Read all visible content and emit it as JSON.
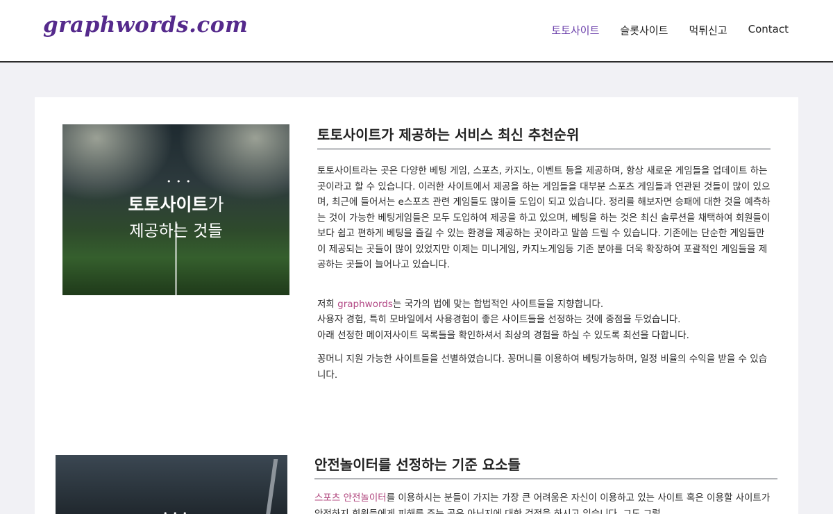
{
  "header": {
    "logo": "graphwords.com",
    "nav": [
      {
        "label": "토토사이트",
        "active": true
      },
      {
        "label": "슬롯사이트",
        "active": false
      },
      {
        "label": "먹튀신고",
        "active": false
      },
      {
        "label": "Contact",
        "active": false
      }
    ]
  },
  "section1": {
    "image": {
      "title_bold": "토토사이트",
      "title_rest": "가",
      "subtitle": "제공하는 것들",
      "dots": "• • •"
    },
    "title": "토토사이트가 제공하는 서비스 최신 추천순위",
    "para1": "토토사이트라는 곳은 다양한 베팅 게임, 스포츠, 카지노, 이벤트 등을 제공하며, 항상 새로운 게임들을 업데이트 하는 곳이라고 할 수 있습니다. 이러한 사이트에서 제공을 하는 게임들을 대부분 스포츠 게임들과 연관된 것들이 많이 있으며, 최근에 들어서는 e스포츠 관련 게임들도 많이들 도입이 되고 있습니다. 정리를 해보자면 승패에 대한 것을 예측하는 것이 가능한 베팅게임들은 모두 도입하여 제공을 하고 있으며, 베팅을 하는 것은 최신 솔루션을 채택하여 회원들이 보다 쉽고 편하게 베팅을 즐길 수 있는 환경을 제공하는 곳이라고 말씀 드릴 수 있습니다. 기존에는 단순한 게임들만이 제공되는 곳들이 많이 있었지만 이제는 미니게임, 카지노게임등 기존 분야를 더욱 확장하여 포괄적인 게임들을 제공하는 곳들이 늘어나고 있습니다.",
    "para2_prefix": "저희 ",
    "para2_brand": "graphwords",
    "para2_suffix": "는 국가의 법에 맞는 합법적인 사이트들을 지향합니다.",
    "para2_line2": "사용자 경험, 특히 모바일에서 사용경험이 좋은 사이트들을 선정하는 것에 중점을 두었습니다.",
    "para2_line3": "아래 선정한 메이저사이트 목록들을 확인하셔서 최상의 경험을 하실 수 있도록 최선을 다합니다.",
    "para3": "꽁머니 지원 가능한 사이트들을 선별하였습니다. 꽁머니를 이용하여 베팅가능하며, 일정 비율의 수익을 받을 수 있습니다."
  },
  "section2": {
    "image": {
      "dots": "• • •"
    },
    "title": "안전놀이터를 선정하는 기준 요소들",
    "link1": "스포츠",
    "link2": "안전놀이터",
    "para": "를 이용하시는 분들이 가지는 가장 큰 어려움은 자신이 이용하고 있는 사이트 혹은 이용할 사이트가 안전하지 회원들에게 피해를 주는 곳은 아닌지에 대한 걱정을 하시고 있습니다. 그도 그럴"
  }
}
